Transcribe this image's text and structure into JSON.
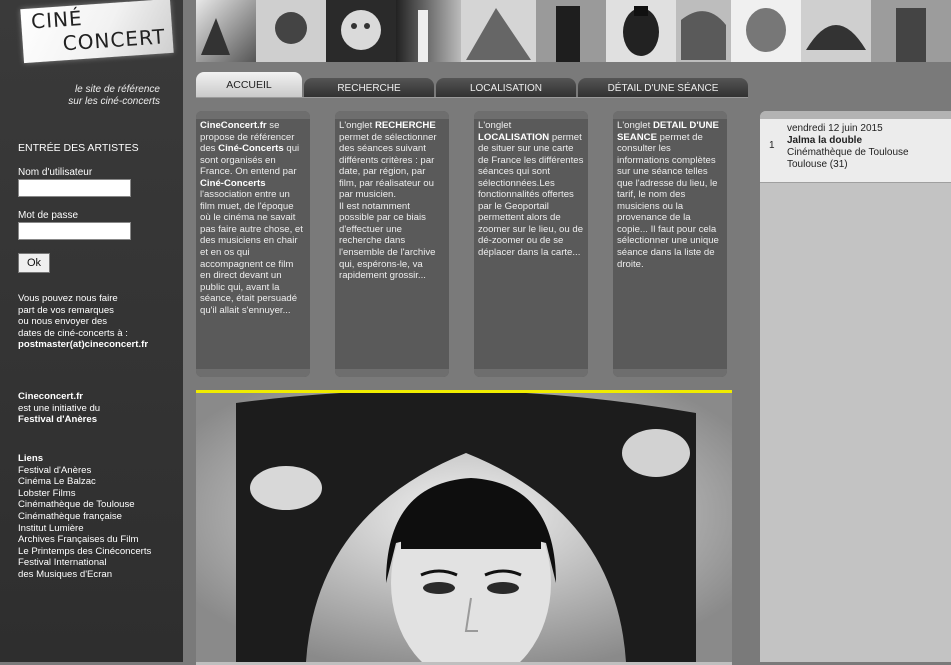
{
  "logo": {
    "line1": "CINÉ",
    "line2": "CONCERT"
  },
  "tagline": {
    "line1": "le site de référence",
    "line2": "sur les ciné-concerts"
  },
  "login": {
    "title": "ENTRÉE DES ARTISTES",
    "username_label": "Nom d'utilisateur",
    "password_label": "Mot de passe",
    "ok_label": "Ok",
    "username_value": "",
    "password_value": ""
  },
  "contact": {
    "lines": [
      "Vous pouvez nous faire",
      "part de vos remarques",
      "ou nous envoyer des",
      "dates de ciné-concerts à :"
    ],
    "email": "postmaster(at)cineconcert.fr"
  },
  "initiative": {
    "site": "Cineconcert.fr",
    "text": "est une initiative du",
    "festival": "Festival d'Anères"
  },
  "links": {
    "title": "Liens",
    "items": [
      "Festival d'Anères",
      "Cinéma Le Balzac",
      "Lobster Films",
      "Cinémathèque de Toulouse",
      "Cinémathèque française",
      "Institut Lumière",
      "Archives Françaises du Film",
      "Le Printemps des Cinéconcerts",
      "Festival International",
      "des Musiques d'Ecran"
    ]
  },
  "tabs": [
    "ACCUEIL",
    "RECHERCHE",
    "LOCALISATION",
    "DÉTAIL D'UNE SÉANCE"
  ],
  "boxes": {
    "b1": {
      "p1": "CineConcert.fr",
      "p2": " se propose de référencer des ",
      "p3": "Ciné-Concerts",
      "p4": " qui sont organisés en France. On entend par ",
      "p5": "Ciné-Concerts",
      "p6": " l'association entre un film muet, de l'époque où le cinéma ne savait pas faire autre chose, et des musiciens en chair et en os qui accompagnent ce film en direct devant un public qui, avant la séance, était persuadé qu'il allait s'ennuyer..."
    },
    "b2": {
      "p1": "L'onglet ",
      "p2": "RECHERCHE",
      "p3": " permet de sélectionner des séances suivant différents critères : par date, par région, par film, par réalisateur ou par musicien.",
      "p4": "Il est notamment possible par ce biais d'effectuer une recherche dans l'ensemble de l'archive qui, espérons-le, va rapidement grossir..."
    },
    "b3": {
      "p1": "L'onglet ",
      "p2": "LOCALISATION",
      "p3": " permet de situer sur une carte de France les différentes séances qui sont sélectionnées.Les fonctionnalités offertes par le Geoportail permettent alors de zoomer sur le lieu, ou de dé-zoomer ou de se déplacer dans la carte..."
    },
    "b4": {
      "p1": "L'onglet ",
      "p2": "DETAIL D'UNE SEANCE",
      "p3": " permet de consulter les informations complètes sur une séance telles que l'adresse du lieu, le tarif, le nom des musiciens ou la provenance de la copie... Il faut pour cela sélectionner une unique séance dans la liste de droite."
    }
  },
  "seances": [
    {
      "num": "1",
      "date": "vendredi 12 juin 2015",
      "title": "Jalma la double",
      "venue": "Cinémathèque de Toulouse",
      "city": "Toulouse (31)"
    }
  ],
  "colors": {
    "accent_yellow": "#f0ec00",
    "sidebar": "#333333",
    "background": "#7a7a7a"
  }
}
